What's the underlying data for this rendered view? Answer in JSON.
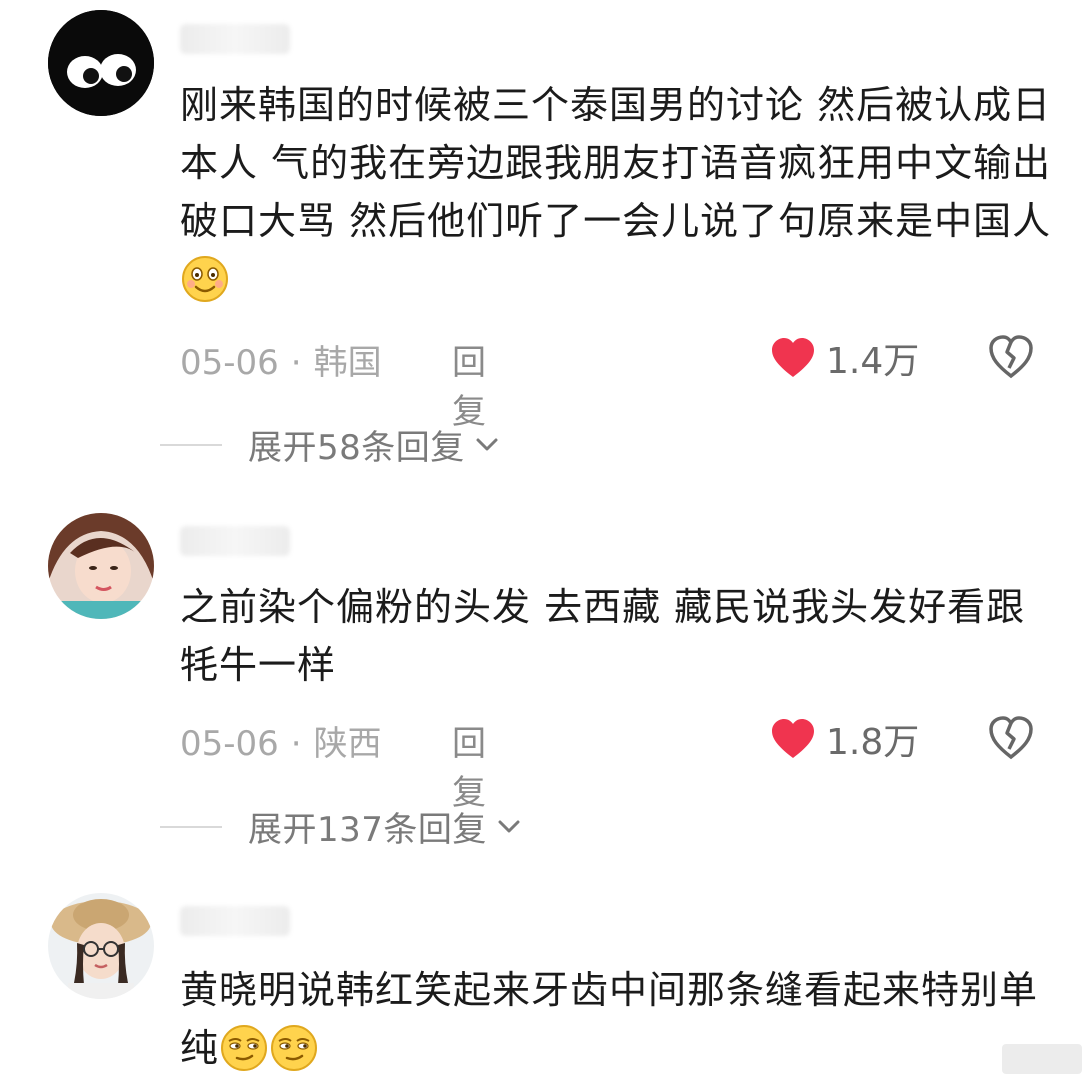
{
  "comments": [
    {
      "text": "刚来韩国的时候被三个泰国男的讨论 然后被认成日本人 气的我在旁边跟我朋友打语音疯狂用中文输出破口大骂 然后他们听了一会儿说了句原来是中国人",
      "date": "05-06",
      "location": "韩国",
      "reply_label": "回复",
      "likes": "1.4万",
      "expand_label": "展开58条回复",
      "avatar_icon": "cartoon-eyes-avatar"
    },
    {
      "text": "之前染个偏粉的头发 去西藏 藏民说我头发好看跟牦牛一样",
      "date": "05-06",
      "location": "陕西",
      "reply_label": "回复",
      "likes": "1.8万",
      "expand_label": "展开137条回复",
      "avatar_icon": "girl-photo-avatar"
    },
    {
      "text": "黄晓明说韩红笑起来牙齿中间那条缝看起来特别单纯",
      "avatar_icon": "girl-hat-photo-avatar"
    }
  ],
  "colors": {
    "heart": "#f0344f",
    "meta_text": "#a8a8a8",
    "body_text": "#1b1b1b"
  }
}
